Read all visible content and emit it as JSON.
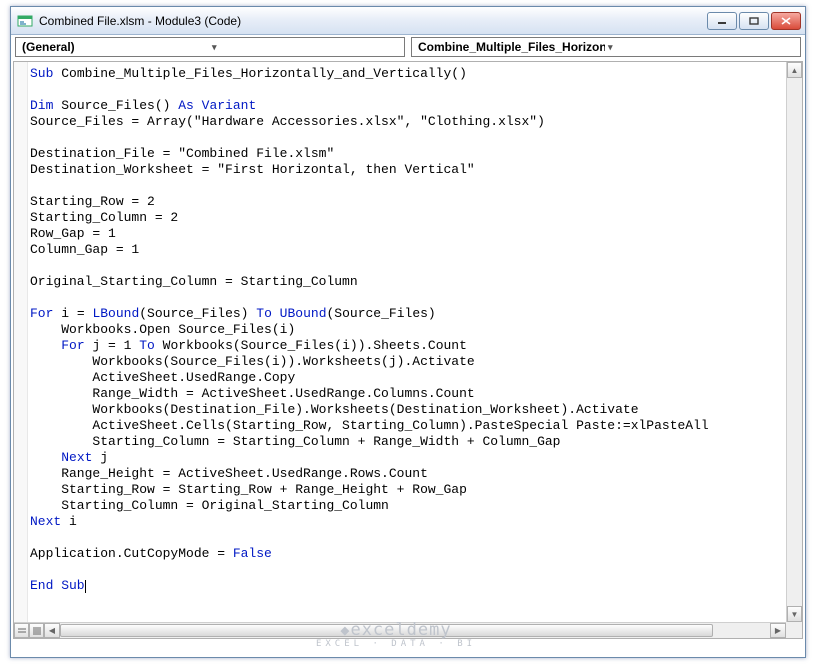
{
  "window": {
    "title": "Combined File.xlsm - Module3 (Code)"
  },
  "dropdowns": {
    "object": "(General)",
    "proc": "Combine_Multiple_Files_Horizontally_and_Vertically"
  },
  "watermark": {
    "main": "exceldemy",
    "sub": "EXCEL · DATA · BI"
  },
  "code": {
    "sub_name": "Combine_Multiple_Files_Horizontally_and_Vertically()",
    "dim_line_var": "Source_Files()",
    "array_assign": "Source_Files = Array(\"Hardware Accessories.xlsx\", \"Clothing.xlsx\")",
    "dest_file": "Destination_File = \"Combined File.xlsm\"",
    "dest_ws": "Destination_Worksheet = \"First Horizontal, then Vertical\"",
    "srow": "Starting_Row = 2",
    "scol": "Starting_Column = 2",
    "rgap": "Row_Gap = 1",
    "cgap": "Column_Gap = 1",
    "orig_col": "Original_Starting_Column = Starting_Column",
    "for_i_a": "i = ",
    "for_i_b": "(Source_Files) ",
    "for_i_c": "(Source_Files)",
    "open_line": "    Workbooks.Open Source_Files(i)",
    "for_j_a": "    ",
    "for_j_b": "j = 1 ",
    "for_j_c": "Workbooks(Source_Files(i)).Sheets.Count",
    "j1": "        Workbooks(Source_Files(i)).Worksheets(j).Activate",
    "j2": "        ActiveSheet.UsedRange.Copy",
    "j3": "        Range_Width = ActiveSheet.UsedRange.Columns.Count",
    "j4": "        Workbooks(Destination_File).Worksheets(Destination_Worksheet).Activate",
    "j5": "        ActiveSheet.Cells(Starting_Row, Starting_Column).PasteSpecial Paste:=xlPasteAll",
    "j6": "        Starting_Column = Starting_Column + Range_Width + Column_Gap",
    "next_j_a": "    ",
    "next_j_b": "j",
    "i1": "    Range_Height = ActiveSheet.UsedRange.Rows.Count",
    "i2": "    Starting_Row = Starting_Row + Range_Height + Row_Gap",
    "i3": "    Starting_Column = Original_Starting_Column",
    "next_i_b": "i",
    "cutcopy_a": "Application.CutCopyMode = "
  }
}
